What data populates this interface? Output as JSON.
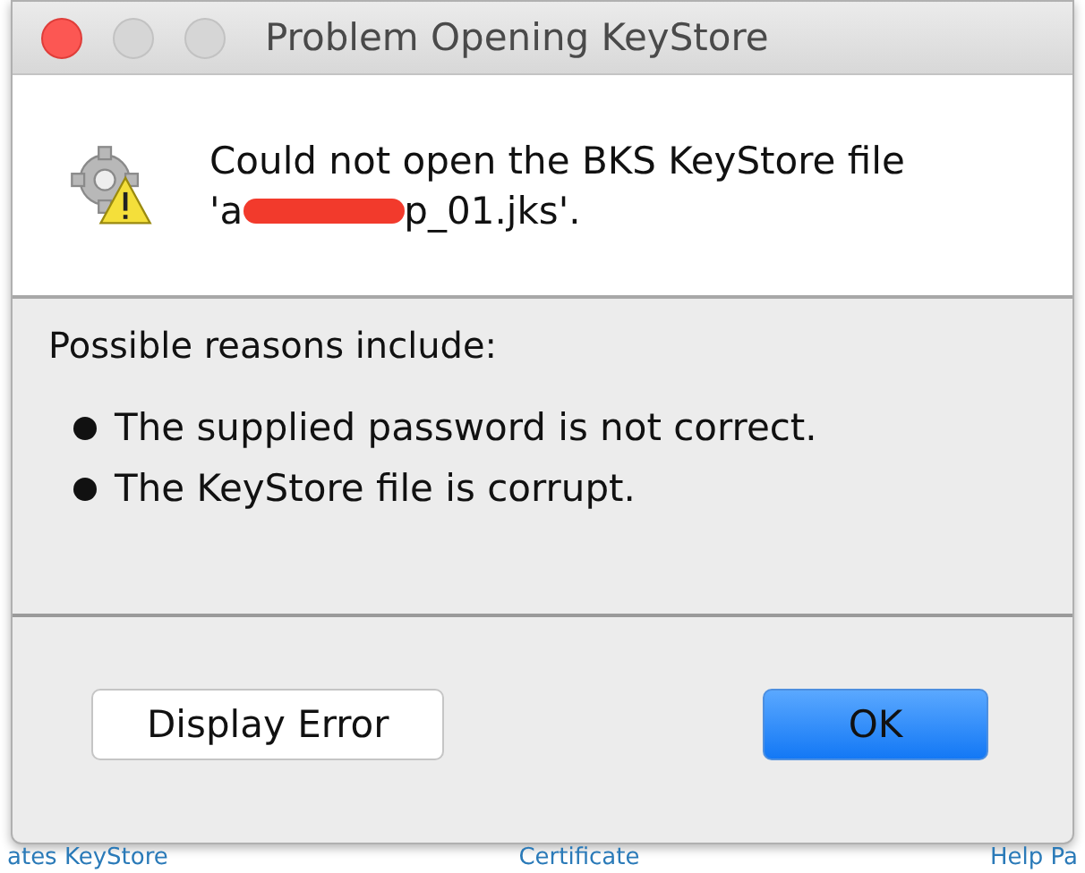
{
  "window": {
    "title": "Problem Opening KeyStore",
    "controls": [
      {
        "kind": "close"
      },
      {
        "kind": "minimize"
      },
      {
        "kind": "zoom"
      }
    ]
  },
  "message": {
    "line_1": "Could not open the BKS KeyStore file",
    "line_2_start": "'a",
    "line_2_end": "p_01.jks'.",
    "redacted": true
  },
  "reasons": {
    "heading": "Possible reasons include:",
    "items": [
      "The supplied password is not correct.",
      "The KeyStore file is corrupt."
    ]
  },
  "buttons": [
    {
      "label": "Display Error",
      "default": false
    },
    {
      "label": "OK",
      "default": true
    }
  ],
  "background_links": [
    "ates KeyStore",
    "Certificate",
    "Help Pa"
  ]
}
